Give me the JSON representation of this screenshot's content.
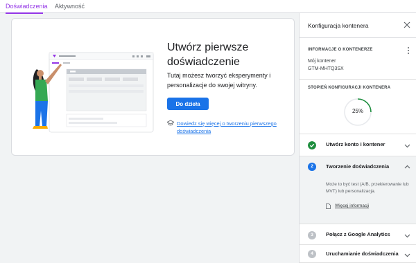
{
  "tabs": [
    {
      "label": "Doświadczenia",
      "active": true
    },
    {
      "label": "Aktywność",
      "active": false
    }
  ],
  "hero": {
    "title": "Utwórz pierwsze doświadczenie",
    "description": "Tutaj możesz tworzyć eksperymenty i personalizacje do swojej witryny.",
    "cta_label": "Do dzieła",
    "learn_more": "Dowiedz się więcej o tworzeniu pierwszego doświadczenia",
    "learn_icon": "graduation-cap-icon"
  },
  "panel": {
    "title": "Konfiguracja kontenera",
    "close_icon": "close-icon",
    "info_heading": "INFORMACJE O KONTENERZE",
    "container_name": "Mój kontener",
    "container_id": "GTM-MHTQ3SX",
    "progress_heading": "STOPIEŃ KONFIGURACJI KONTENERA",
    "progress_percent": 25,
    "progress_label": "25%",
    "steps": [
      {
        "number": "1",
        "label": "Utwórz konto i kontener",
        "status": "done"
      },
      {
        "number": "2",
        "label": "Tworzenie doświadczenia",
        "status": "active",
        "description": "Może to być test (A/B, przekierowanie lub MVT) lub personalizacja.",
        "link": "Więcej informacji"
      },
      {
        "number": "3",
        "label": "Połącz z Google Analytics",
        "status": "pending"
      },
      {
        "number": "4",
        "label": "Uruchamianie doświadczenia",
        "status": "pending"
      }
    ]
  },
  "colors": {
    "accent": "#9334e6",
    "primary": "#1a73e8",
    "success": "#1e8e3e",
    "pending": "#bdc1c6"
  }
}
